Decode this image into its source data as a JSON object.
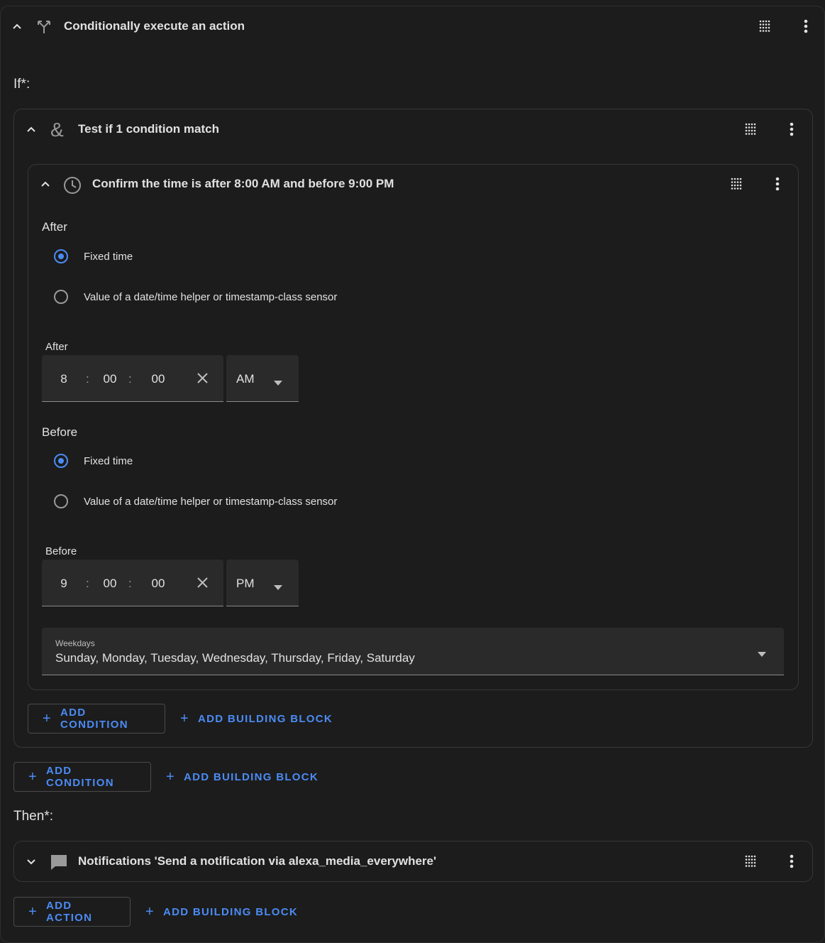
{
  "outer": {
    "title": "Conditionally execute an action"
  },
  "if_label": "If*:",
  "then_label": "Then*:",
  "and_block": {
    "title": "Test if 1 condition match"
  },
  "time_condition": {
    "title": "Confirm the time is after 8:00 AM and before 9:00 PM",
    "after_heading": "After",
    "before_heading": "Before",
    "option_fixed": "Fixed time",
    "option_helper": "Value of a date/time helper or timestamp-class sensor",
    "after": {
      "label": "After",
      "hours": "8",
      "minutes": "00",
      "seconds": "00",
      "period": "AM"
    },
    "before": {
      "label": "Before",
      "hours": "9",
      "minutes": "00",
      "seconds": "00",
      "period": "PM"
    },
    "weekdays": {
      "label": "Weekdays",
      "value": "Sunday, Monday, Tuesday, Wednesday, Thursday, Friday, Saturday"
    }
  },
  "inner_buttons": {
    "add_condition": "ADD CONDITION",
    "add_building_block": "ADD BUILDING BLOCK"
  },
  "outer_buttons": {
    "add_condition": "ADD CONDITION",
    "add_building_block": "ADD BUILDING BLOCK"
  },
  "action": {
    "title": "Notifications 'Send a notification via alexa_media_everywhere'"
  },
  "action_buttons": {
    "add_action": "ADD ACTION",
    "add_building_block": "ADD BUILDING BLOCK"
  },
  "colors": {
    "accent": "#4b8bf5",
    "background": "#1c1c1c",
    "field": "#2a2a2a"
  }
}
